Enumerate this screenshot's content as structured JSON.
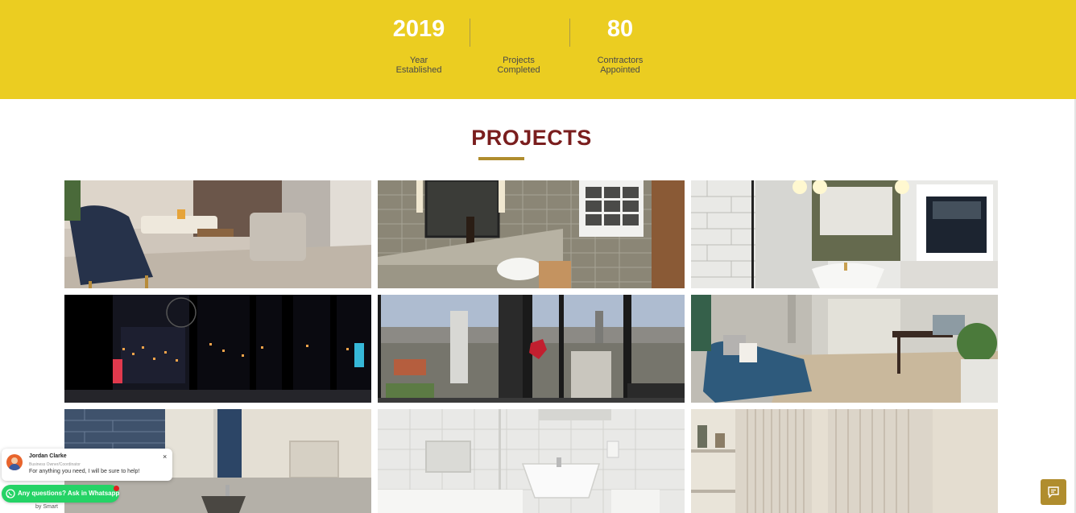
{
  "stats": [
    {
      "value": "2019",
      "label": "Year\nEstablished"
    },
    {
      "value": "",
      "label": "Projects\nCompleted"
    },
    {
      "value": "80",
      "label": "Contractors\nAppointed"
    }
  ],
  "projects": {
    "title": "PROJECTS",
    "images": [
      "living-room-photo",
      "bathroom-vanity-photo",
      "bathroom-mirror-window-photo",
      "night-city-view-photo",
      "day-city-view-photo",
      "home-office-photo",
      "tiled-bathroom-basin-photo",
      "white-bathroom-photo",
      "panelled-hallway-photo"
    ]
  },
  "whatsapp": {
    "agent_name": "Jordan Clarke",
    "agent_role": "Business Owner/Coordinator",
    "message": "For anything you need, I will be sure to help!",
    "close_label": "×",
    "button_label": "Any questions? Ask in Whatsapp",
    "powered_by": "by Smart"
  },
  "colors": {
    "band": "#ebcd21",
    "title": "#7a1e1e",
    "accent": "#b08d2e",
    "whatsapp_green": "#25d366"
  },
  "icons": [
    "whatsapp-icon",
    "chat-icon",
    "close-icon"
  ]
}
